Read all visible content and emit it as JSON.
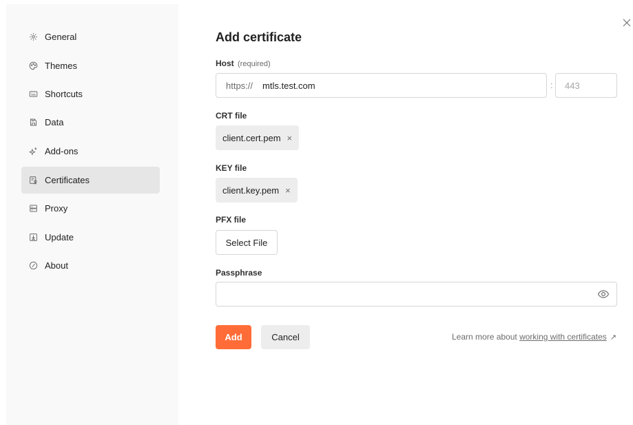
{
  "sidebar": {
    "items": [
      {
        "label": "General",
        "icon": "gear-icon",
        "active": false
      },
      {
        "label": "Themes",
        "icon": "palette-icon",
        "active": false
      },
      {
        "label": "Shortcuts",
        "icon": "keyboard-icon",
        "active": false
      },
      {
        "label": "Data",
        "icon": "data-icon",
        "active": false
      },
      {
        "label": "Add-ons",
        "icon": "sparkle-icon",
        "active": false
      },
      {
        "label": "Certificates",
        "icon": "certificate-icon",
        "active": true
      },
      {
        "label": "Proxy",
        "icon": "server-icon",
        "active": false
      },
      {
        "label": "Update",
        "icon": "download-icon",
        "active": false
      },
      {
        "label": "About",
        "icon": "info-icon",
        "active": false
      }
    ]
  },
  "form": {
    "title": "Add certificate",
    "host": {
      "label": "Host",
      "required_note": "(required)",
      "protocol": "https://",
      "value": "mtls.test.com",
      "port_separator": ":",
      "port_placeholder": "443"
    },
    "crt": {
      "label": "CRT file",
      "file": "client.cert.pem",
      "remove": "×"
    },
    "key": {
      "label": "KEY file",
      "file": "client.key.pem",
      "remove": "×"
    },
    "pfx": {
      "label": "PFX file",
      "button": "Select File"
    },
    "passphrase": {
      "label": "Passphrase",
      "value": "",
      "toggle_icon": "eye-icon"
    },
    "actions": {
      "add": "Add",
      "cancel": "Cancel"
    },
    "learn_more": {
      "prefix": "Learn more about ",
      "link": "working with certificates",
      "arrow": "↗"
    }
  },
  "colors": {
    "accent": "#ff6c37",
    "sidebar_bg": "#f9f9f9",
    "active_item_bg": "#e6e6e6"
  }
}
